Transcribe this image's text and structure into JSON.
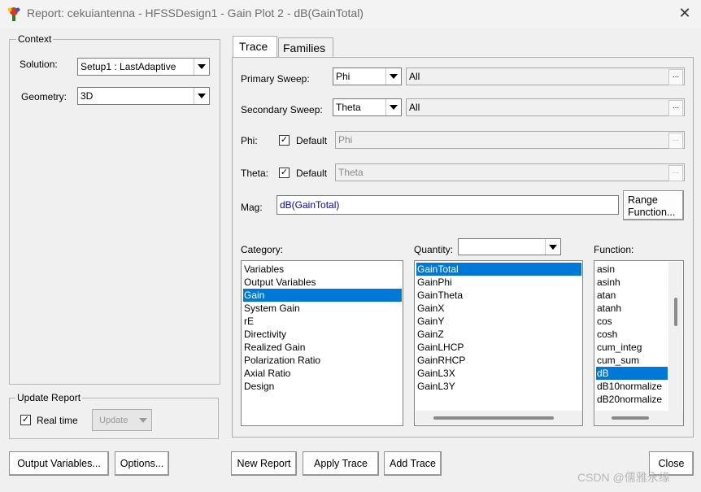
{
  "window": {
    "title": "Report: cekuiantenna - HFSSDesign1 - Gain Plot 2 - dB(GainTotal)",
    "close_glyph": "✕"
  },
  "context": {
    "group_label": "Context",
    "solution_label": "Solution:",
    "solution_value": "Setup1 : LastAdaptive",
    "geometry_label": "Geometry:",
    "geometry_value": "3D"
  },
  "update_report": {
    "group_label": "Update Report",
    "realtime_label": "Real time",
    "realtime_checked": true,
    "update_button": "Update"
  },
  "tabs": [
    {
      "label": "Trace",
      "active": true
    },
    {
      "label": "Families",
      "active": false
    }
  ],
  "trace": {
    "primary_sweep_label": "Primary Sweep:",
    "primary_sweep_value": "Phi",
    "primary_sweep_range": "All",
    "secondary_sweep_label": "Secondary Sweep:",
    "secondary_sweep_value": "Theta",
    "secondary_sweep_range": "All",
    "phi_label": "Phi:",
    "phi_default_label": "Default",
    "phi_value": "Phi",
    "theta_label": "Theta:",
    "theta_default_label": "Default",
    "theta_value": "Theta",
    "mag_label": "Mag:",
    "mag_value": "dB(GainTotal)",
    "range_function_line1": "Range",
    "range_function_line2": "Function...",
    "dots": "..."
  },
  "category": {
    "label": "Category:",
    "items": [
      "Variables",
      "Output Variables",
      "Gain",
      "System Gain",
      "rE",
      "Directivity",
      "Realized Gain",
      "Polarization Ratio",
      "Axial Ratio",
      "Design"
    ],
    "selected_index": 2
  },
  "quantity": {
    "label": "Quantity:",
    "filter_value": "",
    "items": [
      "GainTotal",
      "GainPhi",
      "GainTheta",
      "GainX",
      "GainY",
      "GainZ",
      "GainLHCP",
      "GainRHCP",
      "GainL3X",
      "GainL3Y"
    ],
    "selected_index": 0
  },
  "function": {
    "label": "Function:",
    "items": [
      "asin",
      "asinh",
      "atan",
      "atanh",
      "cos",
      "cosh",
      "cum_integ",
      "cum_sum",
      "dB",
      "dB10normalize",
      "dB20normalize"
    ],
    "selected_index": 8
  },
  "buttons": {
    "output_variables": "Output Variables...",
    "options": "Options...",
    "new_report": "New Report",
    "apply_trace": "Apply Trace",
    "add_trace": "Add Trace",
    "close": "Close"
  },
  "watermark": "CSDN @儒雅永缘",
  "colors": {
    "selection": "#0078d7",
    "mag_text": "#0000cc"
  }
}
